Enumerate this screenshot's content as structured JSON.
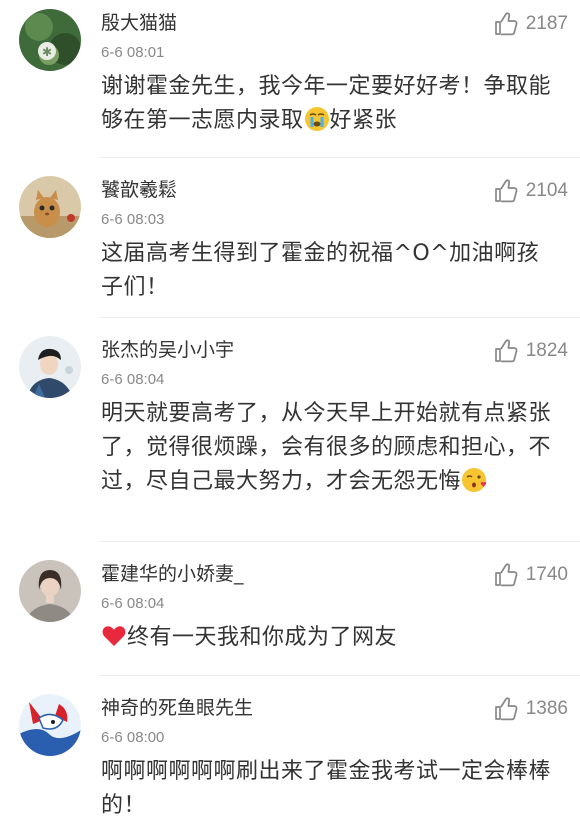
{
  "accent_color": "#333333",
  "secondary_text_color": "#888888",
  "icon_color": "#888888",
  "comments": [
    {
      "username": "殷大猫猫",
      "time": "6-6 08:01",
      "likes": "2187",
      "text_before": "谢谢霍金先生，我今年一定要好好考！争取能够在第一志愿内录取",
      "emoji": "crying-face-emoji",
      "text_after": "好紧张"
    },
    {
      "username": "饕歆羲鬆",
      "time": "6-6 08:03",
      "likes": "2104",
      "text_before": "这届高考生得到了霍金的祝福^O^加油啊孩子们！",
      "emoji": "",
      "text_after": ""
    },
    {
      "username": "张杰的吴小小宇",
      "time": "6-6 08:04",
      "likes": "1824",
      "text_before": "明天就要高考了，从今天早上开始就有点紧张了，觉得很烦躁，会有很多的顾虑和担心，不过，尽自己最大努力，才会无怨无悔",
      "emoji": "kissing-face-emoji",
      "text_after": ""
    },
    {
      "username": "霍建华的小娇妻_",
      "time": "6-6 08:04",
      "likes": "1740",
      "text_before": "",
      "emoji": "red-heart-emoji",
      "text_after": "终有一天我和你成为了网友"
    },
    {
      "username": "神奇的死鱼眼先生",
      "time": "6-6 08:00",
      "likes": "1386",
      "text_before": "啊啊啊啊啊啊刷出来了霍金我考试一定会棒棒的！",
      "emoji": "",
      "text_after": ""
    }
  ]
}
